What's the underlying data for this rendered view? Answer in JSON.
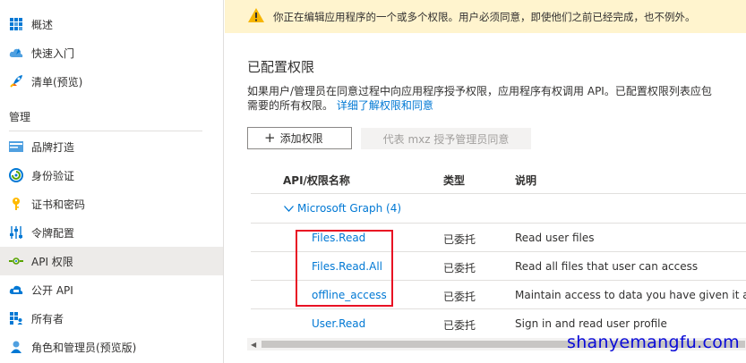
{
  "sidebar": {
    "items_top": [
      {
        "label": "概述",
        "icon": "grid-icon"
      },
      {
        "label": "快速入门",
        "icon": "cloud-rocket-icon"
      },
      {
        "label": "清单(预览)",
        "icon": "rocket-icon"
      }
    ],
    "section_title": "管理",
    "items_manage": [
      {
        "label": "品牌打造",
        "icon": "branding-icon"
      },
      {
        "label": "身份验证",
        "icon": "authentication-icon"
      },
      {
        "label": "证书和密码",
        "icon": "key-icon"
      },
      {
        "label": "令牌配置",
        "icon": "token-config-icon"
      },
      {
        "label": "API 权限",
        "icon": "api-permissions-icon",
        "active": true
      },
      {
        "label": "公开 API",
        "icon": "expose-api-icon"
      },
      {
        "label": "所有者",
        "icon": "owners-icon"
      },
      {
        "label": "角色和管理员(预览版)",
        "icon": "roles-icon"
      }
    ]
  },
  "banner": {
    "text": "你正在编辑应用程序的一个或多个权限。用户必须同意，即使他们之前已经完成，也不例外。",
    "icon": "warning-icon"
  },
  "main": {
    "title": "已配置权限",
    "description_line1": "如果用户/管理员在同意过程中向应用程序授予权限，应用程序有权调用 API。已配置权限列表应包",
    "description_line2_prefix": "需要的所有权限。",
    "description_link": "详细了解权限和同意",
    "add_button": "添加权限",
    "grant_button": "代表 mxz 授予管理员同意"
  },
  "table": {
    "headers": {
      "name": "API/权限名称",
      "type": "类型",
      "description": "说明"
    },
    "group": "Microsoft Graph (4)",
    "rows": [
      {
        "name": "Files.Read",
        "type": "已委托",
        "description": "Read user files"
      },
      {
        "name": "Files.Read.All",
        "type": "已委托",
        "description": "Read all files that user can access"
      },
      {
        "name": "offline_access",
        "type": "已委托",
        "description": "Maintain access to data you have given it acc"
      },
      {
        "name": "User.Read",
        "type": "已委托",
        "description": "Sign in and read user profile"
      }
    ]
  },
  "watermark": "shanyemangfu.com",
  "colors": {
    "accent": "#0078d4",
    "banner_bg": "#fff4ce",
    "highlight": "#e81123",
    "warning": "#f7b500"
  }
}
